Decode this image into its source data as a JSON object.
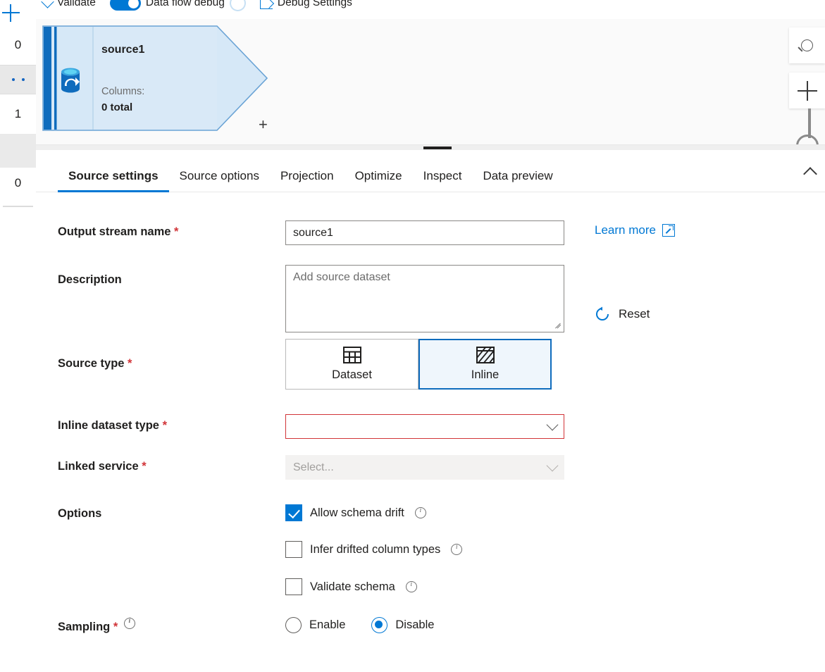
{
  "toolbar": {
    "validate_label": "Validate",
    "data_flow_debug_label": "Data flow debug",
    "debug_settings_label": "Debug Settings"
  },
  "left_rail": {
    "add_label": "+",
    "rows": [
      {
        "value": "0"
      },
      {
        "value": "1"
      },
      {
        "value": "0"
      }
    ]
  },
  "canvas": {
    "node": {
      "title": "source1",
      "columns_label": "Columns:",
      "columns_value": "0 total",
      "add_branch_label": "+",
      "fill_color": "#d6e8f7",
      "border_color": "#6aa3d5",
      "accent_color": "#0f6cbd"
    },
    "search_icon": "search-icon",
    "zoom_in_label": "+"
  },
  "panel": {
    "tabs": [
      {
        "label": "Source settings",
        "active": true
      },
      {
        "label": "Source options",
        "active": false
      },
      {
        "label": "Projection",
        "active": false
      },
      {
        "label": "Optimize",
        "active": false
      },
      {
        "label": "Inspect",
        "active": false
      },
      {
        "label": "Data preview",
        "active": false
      }
    ],
    "form": {
      "output_stream_name": {
        "label": "Output stream name",
        "required": "*",
        "value": "source1"
      },
      "description": {
        "label": "Description",
        "value": "",
        "placeholder": "Add source dataset"
      },
      "source_type": {
        "label": "Source type",
        "required": "*",
        "options": [
          {
            "label": "Dataset",
            "icon": "table-grid-icon",
            "selected": false
          },
          {
            "label": "Inline",
            "icon": "hatched-square-icon",
            "selected": true
          }
        ]
      },
      "inline_dataset_type": {
        "label": "Inline dataset type",
        "required": "*",
        "value": "",
        "error": true
      },
      "linked_service": {
        "label": "Linked service",
        "required": "*",
        "value": "",
        "placeholder": "Select...",
        "disabled": true
      },
      "options": {
        "label": "Options",
        "items": [
          {
            "label": "Allow schema drift",
            "checked": true
          },
          {
            "label": "Infer drifted column types",
            "checked": false
          },
          {
            "label": "Validate schema",
            "checked": false
          }
        ]
      },
      "sampling": {
        "label": "Sampling",
        "required": "*",
        "options": [
          {
            "label": "Enable",
            "selected": false
          },
          {
            "label": "Disable",
            "selected": true
          }
        ]
      }
    },
    "actions": {
      "learn_more_label": "Learn more",
      "reset_label": "Reset"
    }
  },
  "colors": {
    "accent": "#0078d4",
    "error": "#d13438",
    "selected_bg": "#eff6fc"
  }
}
